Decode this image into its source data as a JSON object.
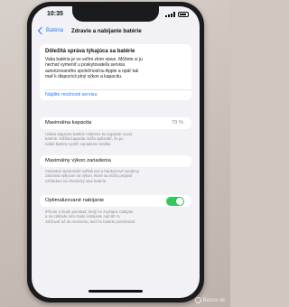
{
  "status_bar": {
    "time": "10:35"
  },
  "nav": {
    "back_label": "Batéria",
    "title": "Zdravie a nabíjanie batérie"
  },
  "notice": {
    "title": "Dôležitá správa týkajúca sa batérie",
    "lines": [
      "Vaša batéria je vo veľmi zlom stave. Môžete si ju",
      "nechať vymeniť u poskytovateľa servisu",
      "autorizovaného spoločnosťou Apple a opäť tak",
      "mať k dispozícii plný výkon a kapacitu."
    ],
    "link": "Nájdite možnosti servisu"
  },
  "max_capacity": {
    "label": "Maximálna kapacita",
    "value": "79 %",
    "footnote": [
      "Udáva kapacitu batérie relatívne ku kapacite novej",
      "batérie. Nižšia kapacita môže spôsobiť, že po",
      "nabití batérie vydrží zariadenie kratšie."
    ]
  },
  "performance": {
    "label": "Maximálny výkon zariadenia",
    "footnote": [
      "Vstavané dynamické softvérové a hardvérové systémy",
      "zabránia vplyvom na výkon, ktoré sa môžu prejaviť",
      "vzhľadom na chemický stav batérie."
    ]
  },
  "optimized": {
    "label": "Optimalizované nabíjanie",
    "enabled": true,
    "footnote": [
      "iPhone si bude pamätať, kedy ho zvyčajne nabíjate,",
      "a na základe toho bude nabíjanie nad 80 %",
      "zdržovať až do momentu, keď ho budete potrebovať."
    ]
  },
  "watermark": {
    "text": "Bazos.sk"
  },
  "colors": {
    "accent": "#2f7bf6",
    "toggle_on": "#34c759",
    "background": "#f2f2f6"
  }
}
